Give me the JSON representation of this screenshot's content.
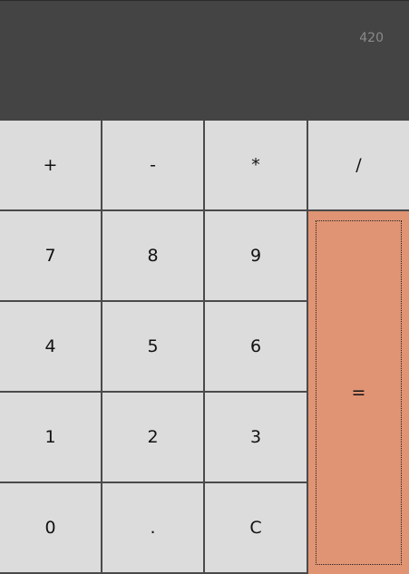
{
  "display": {
    "value": "420"
  },
  "keys": {
    "add": "+",
    "subtract": "-",
    "multiply": "*",
    "divide": "/",
    "seven": "7",
    "eight": "8",
    "nine": "9",
    "four": "4",
    "five": "5",
    "six": "6",
    "one": "1",
    "two": "2",
    "three": "3",
    "zero": "0",
    "decimal": ".",
    "clear": "C",
    "equals": "="
  },
  "colors": {
    "display_bg": "#444444",
    "key_bg": "#dcdcdc",
    "equals_bg": "#e09474",
    "grid_line": "#4a4a4a"
  }
}
